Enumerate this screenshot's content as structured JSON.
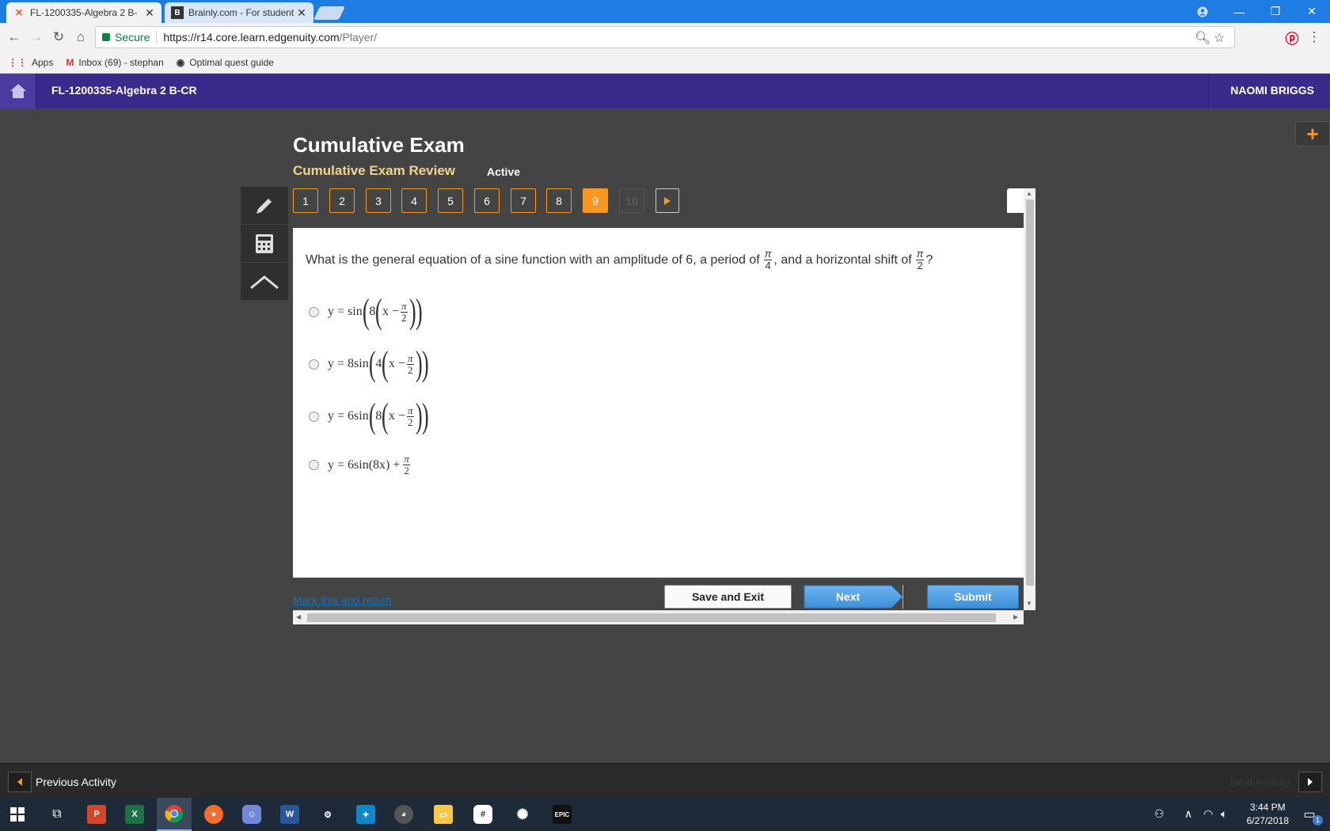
{
  "browser": {
    "tabs": [
      {
        "title": "FL-1200335-Algebra 2 B-",
        "close": "✕"
      },
      {
        "title": "Brainly.com - For student",
        "close": "✕"
      }
    ],
    "secure_label": "Secure",
    "url_host": "https://r14.core.learn.edgenuity.com",
    "url_path": "/Player/",
    "bookmarks": [
      {
        "label": "Apps"
      },
      {
        "label": "Inbox (69) - stephan"
      },
      {
        "label": "Optimal quest guide"
      }
    ]
  },
  "header": {
    "course_title": "FL-1200335-Algebra 2 B-CR",
    "user_name": "NAOMI BRIGGS"
  },
  "exam": {
    "title": "Cumulative Exam",
    "subtitle": "Cumulative Exam Review",
    "status": "Active",
    "question_numbers": [
      "1",
      "2",
      "3",
      "4",
      "5",
      "6",
      "7",
      "8",
      "9",
      "10"
    ],
    "current_question": 9
  },
  "question": {
    "text_before_period": "What is the general equation of a sine function with an amplitude of 6, a period of",
    "text_before_shift": ", and a horizontal shift of",
    "text_end": "?",
    "period_frac": {
      "num": "π",
      "den": "4"
    },
    "shift_frac": {
      "num": "π",
      "den": "2"
    }
  },
  "options": [
    {
      "prefix": "y = sin",
      "coef": "8",
      "inner": "x −",
      "frac_num": "π",
      "frac_den": "2"
    },
    {
      "prefix": "y = 8sin",
      "coef": "4",
      "inner": "x −",
      "frac_num": "π",
      "frac_den": "2"
    },
    {
      "prefix": "y = 6sin",
      "coef": "8",
      "inner": "x −",
      "frac_num": "π",
      "frac_den": "2"
    },
    {
      "prefix": "y = 6sin(8x) +",
      "frac_num": "π",
      "frac_den": "2"
    }
  ],
  "actions": {
    "mark_return": "Mark this and return",
    "save_exit": "Save and Exit",
    "next": "Next",
    "submit": "Submit"
  },
  "activity_bar": {
    "previous": "Previous Activity",
    "next": "Next Activity"
  },
  "taskbar": {
    "time": "3:44 PM",
    "date": "6/27/2018",
    "notification_count": "1"
  },
  "colors": {
    "header_purple": "#3a2a8c",
    "accent_orange": "#f89821",
    "submit_blue": "#3d8fd8"
  }
}
